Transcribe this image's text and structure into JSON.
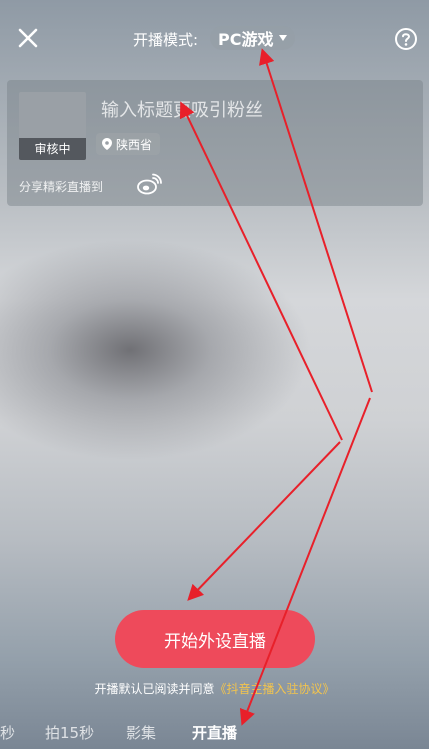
{
  "header": {
    "mode_label": "开播模式:",
    "mode_value": "PC游戏"
  },
  "card": {
    "cover_status": "审核中",
    "title_placeholder": "输入标题更吸引粉丝",
    "location": "陕西省",
    "share_label": "分享精彩直播到"
  },
  "start_button": "开始外设直播",
  "agreement": {
    "prefix": "开播默认已阅读并同意",
    "link": "《抖音主播入驻协议》"
  },
  "tabs": [
    {
      "label": "秒"
    },
    {
      "label": "拍15秒"
    },
    {
      "label": "影集"
    },
    {
      "label": "开直播"
    }
  ],
  "colors": {
    "accent": "#ee4a5b",
    "link": "#f3c44d",
    "annotation": "#e8202a"
  },
  "icons": [
    "close-icon",
    "help-icon",
    "location-pin-icon",
    "weibo-icon",
    "caret-down-icon"
  ]
}
